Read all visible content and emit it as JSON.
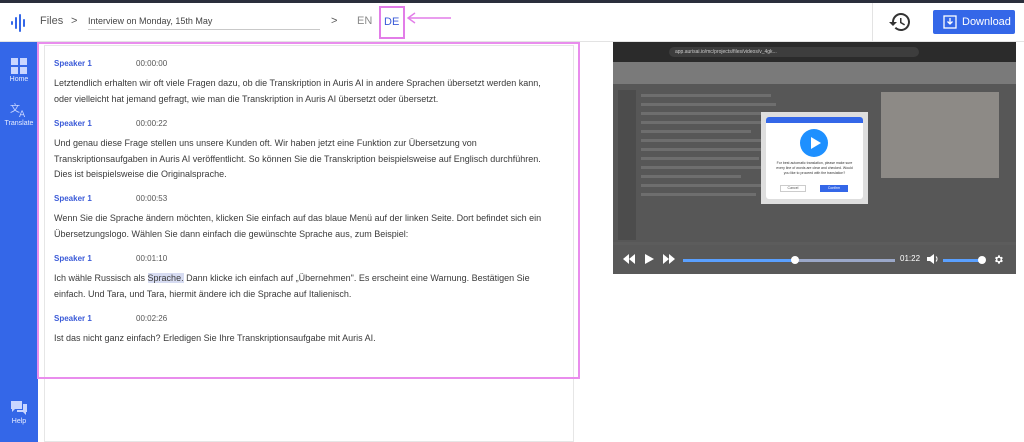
{
  "header": {
    "files_label": "Files",
    "separator": ">",
    "file_title": "Interview on Monday, 15th May",
    "lang_en": "EN",
    "lang_de": "DE",
    "download_label": "Download"
  },
  "sidebar": {
    "items": [
      {
        "label": "Home",
        "icon": "home-grid-icon"
      },
      {
        "label": "Translate",
        "icon": "translate-icon"
      },
      {
        "label": "Help",
        "icon": "chat-help-icon"
      }
    ]
  },
  "transcript": {
    "segments": [
      {
        "speaker": "Speaker 1",
        "time": "00:00:00",
        "text": "Letztendlich erhalten wir oft viele Fragen dazu, ob die Transkription in Auris AI in andere Sprachen übersetzt werden kann, oder vielleicht hat jemand gefragt, wie man die Transkription in Auris AI übersetzt oder übersetzt."
      },
      {
        "speaker": "Speaker 1",
        "time": "00:00:22",
        "text": "Und genau diese Frage stellen uns unsere Kunden oft. Wir haben jetzt eine Funktion zur Übersetzung von Transkriptionsaufgaben in Auris AI veröffentlicht. So können Sie die Transkription beispielsweise auf Englisch durchführen. Dies ist beispielsweise die Originalsprache."
      },
      {
        "speaker": "Speaker 1",
        "time": "00:00:53",
        "text": "Wenn Sie die Sprache ändern möchten, klicken Sie einfach auf das blaue Menü auf der linken Seite. Dort befindet sich ein Übersetzungslogo. Wählen Sie dann einfach die gewünschte Sprache aus, zum Beispiel:"
      },
      {
        "speaker": "Speaker 1",
        "time": "00:01:10",
        "text_before": "Ich wähle Russisch als ",
        "text_highlight": "Sprache.",
        "text_after": " Dann klicke ich einfach auf „Übernehmen\". Es erscheint eine Warnung. Bestätigen Sie einfach. Und Tara, und Tara, hiermit ändere ich die Sprache auf Italienisch."
      },
      {
        "speaker": "Speaker 1",
        "time": "00:02:26",
        "text": "Ist das nicht ganz einfach? Erledigen Sie Ihre Transkriptionsaufgabe mit Auris AI."
      }
    ]
  },
  "video": {
    "current_time": "01:22",
    "progress_fraction": 0.53,
    "volume_fraction": 0.9,
    "browser_url": "app.aurisai.io/mc/projects/files/videos/v_4gk...",
    "modal_text": "For best automatic translation, please make sure every line of words are clear and checked. Would you like to proceed with the translation?",
    "modal_cancel": "Cancel",
    "modal_confirm": "Confirm"
  },
  "colors": {
    "accent": "#3467e8",
    "annotation": "#e98ded",
    "speaker": "#3b5bd8"
  }
}
